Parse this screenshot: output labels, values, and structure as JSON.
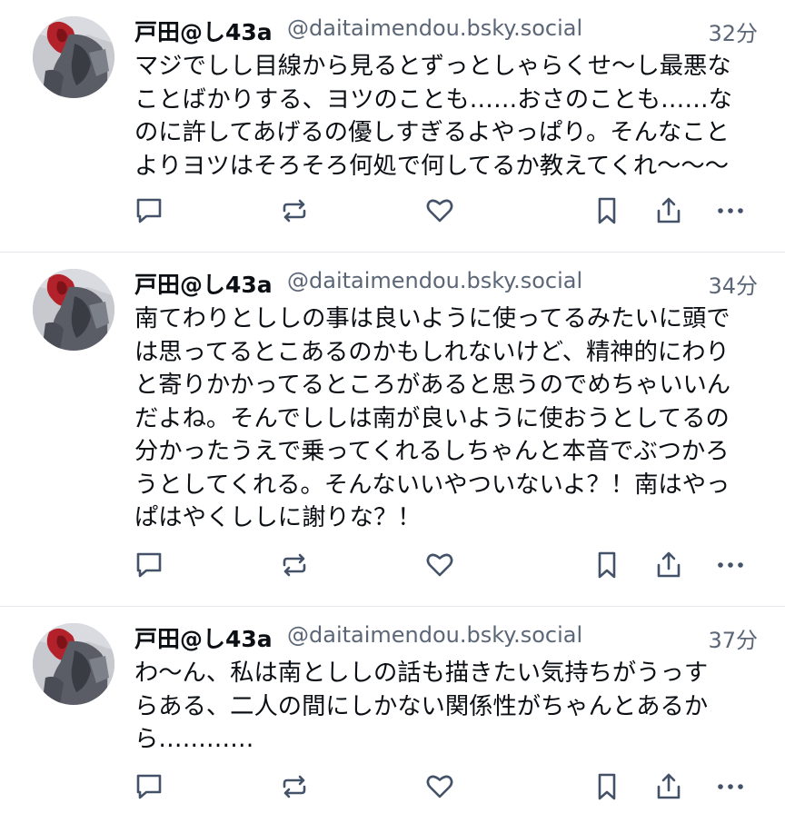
{
  "colors": {
    "text": "#0b0f14",
    "muted": "#5b6677",
    "icon": "#445269",
    "divider": "#e4e7ec"
  },
  "icons": {
    "reply": "speech-bubble-icon",
    "repost": "repost-arrows-icon",
    "like": "heart-icon",
    "bookmark": "bookmark-icon",
    "share": "share-upload-icon",
    "more": "more-dots-icon"
  },
  "posts": [
    {
      "display_name": "戸田@し43a",
      "handle": "@daitaimendou.bsky.social",
      "time": "32分",
      "text": "マジでしし目線から見るとずっとしゃらくせ〜し最悪な\nことばかりする、ヨツのことも……おさのことも……な\nのに許してあげるの優しすぎるよやっぱり。そんなこと\nよりヨツはそろそろ何処で何してるか教えてくれ〜〜〜"
    },
    {
      "display_name": "戸田@し43a",
      "handle": "@daitaimendou.bsky.social",
      "time": "34分",
      "text": "南てわりとししの事は良いように使ってるみたいに頭で\nは思ってるとこあるのかもしれないけど、精神的にわり\nと寄りかかってるところがあると思うのでめちゃいいん\nだよね。そんでししは南が良いように使おうとしてるの\n分かったうえで乗ってくれるしちゃんと本音でぶつかろ\nうとしてくれる。そんないいやついないよ？！南はやっ\nぱはやくししに謝りな？！"
    },
    {
      "display_name": "戸田@し43a",
      "handle": "@daitaimendou.bsky.social",
      "time": "37分",
      "text": "わ〜ん、私は南とししの話も描きたい気持ちがうっす\nらある、二人の間にしかない関係性がちゃんとあるか\nら…………"
    }
  ]
}
